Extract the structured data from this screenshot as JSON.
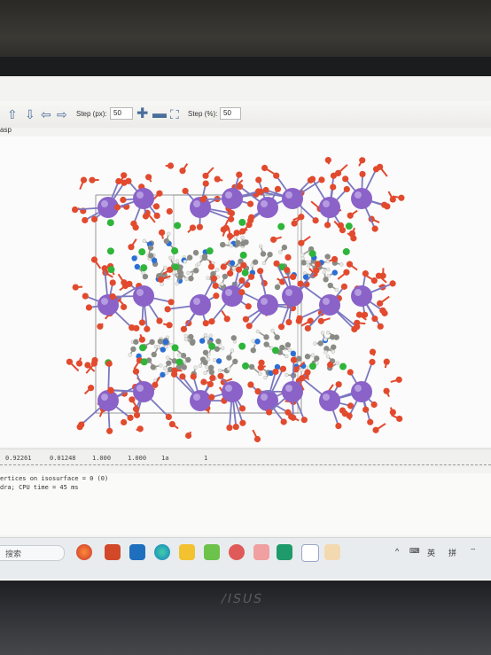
{
  "toolbar": {
    "step_px_label": "Step (px):",
    "step_px_value": "50",
    "step_pct_label": "Step (%):",
    "step_pct_value": "50",
    "icons": [
      "arrow-up-icon",
      "arrow-down-icon",
      "arrow-left-icon",
      "arrow-right-icon",
      "plus-icon",
      "minus-icon",
      "fit-view-icon"
    ]
  },
  "tab": {
    "label": "asp"
  },
  "status_row": [
    "0.92261",
    "0.01248",
    "1.000",
    "1.000",
    "1a",
    "1"
  ],
  "log": {
    "lines": [
      "ertices on isosurface = 0 (0)",
      "dra; CPU time = 45 ms"
    ]
  },
  "taskbar": {
    "search_label": "搜索",
    "tray": [
      "^",
      "英",
      "拼"
    ],
    "app_icons": [
      "firefox-icon",
      "powerpoint-icon",
      "outlook-icon",
      "edge-icon",
      "file-explorer-icon",
      "wechat-icon",
      "game-icon",
      "notes-icon",
      "vesta-icon",
      "settings-icon",
      "person-icon"
    ]
  },
  "colors": {
    "atom_k": "#8a62c8",
    "atom_o": "#e24a2e",
    "atom_cl": "#2fb53a",
    "atom_n": "#2a6fd6",
    "atom_c": "#8b8b86",
    "atom_h": "#e8e8e6",
    "bond": "#7b78c0"
  }
}
